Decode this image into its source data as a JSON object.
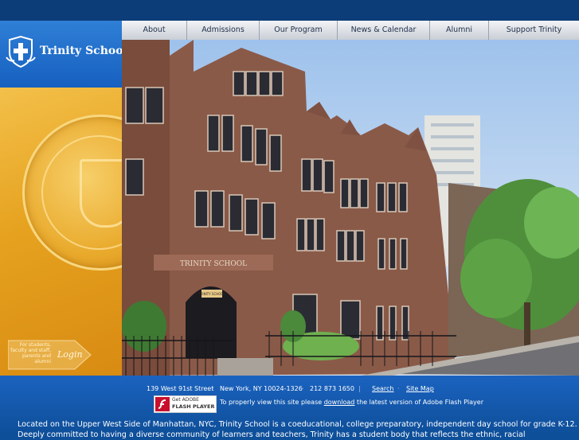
{
  "brand": {
    "name": "Trinity School"
  },
  "nav": {
    "items": [
      {
        "label": "About"
      },
      {
        "label": "Admissions"
      },
      {
        "label": "Our Program"
      },
      {
        "label": "News & Calendar"
      },
      {
        "label": "Alumni"
      },
      {
        "label": "Support Trinity"
      }
    ]
  },
  "login": {
    "note": "For students, faculty and staff, parents and alumni",
    "label": "Login"
  },
  "hero": {
    "building_sign": "TRINITY SCHOOL",
    "door_sign": "TRINITY SCHOOL"
  },
  "footer": {
    "address": "139 West 91st Street",
    "city": "New York, NY 10024-1326",
    "phone": "212 873 1650",
    "search_label": "Search",
    "sitemap_label": "Site Map",
    "flash_badge_top": "Get ADOBE",
    "flash_badge_bottom": "FLASH PLAYER",
    "flash_pre": "To properly view this site please ",
    "flash_link": "download",
    "flash_post": " the latest version of Adobe Flash Player",
    "description_line1": "Located on the Upper West Side of Manhattan, NYC, Trinity School is a coeducational, college preparatory, independent day school for grade K-12.",
    "description_line2": "Deeply committed to having a diverse community of learners and teachers, Trinity has a student body that reflects the ethnic, racial"
  },
  "colors": {
    "header_bg": "#0d3d78",
    "brand_blue": "#1660c0",
    "gold": "#e6a21f",
    "footer_blue": "#0e4f9a"
  }
}
